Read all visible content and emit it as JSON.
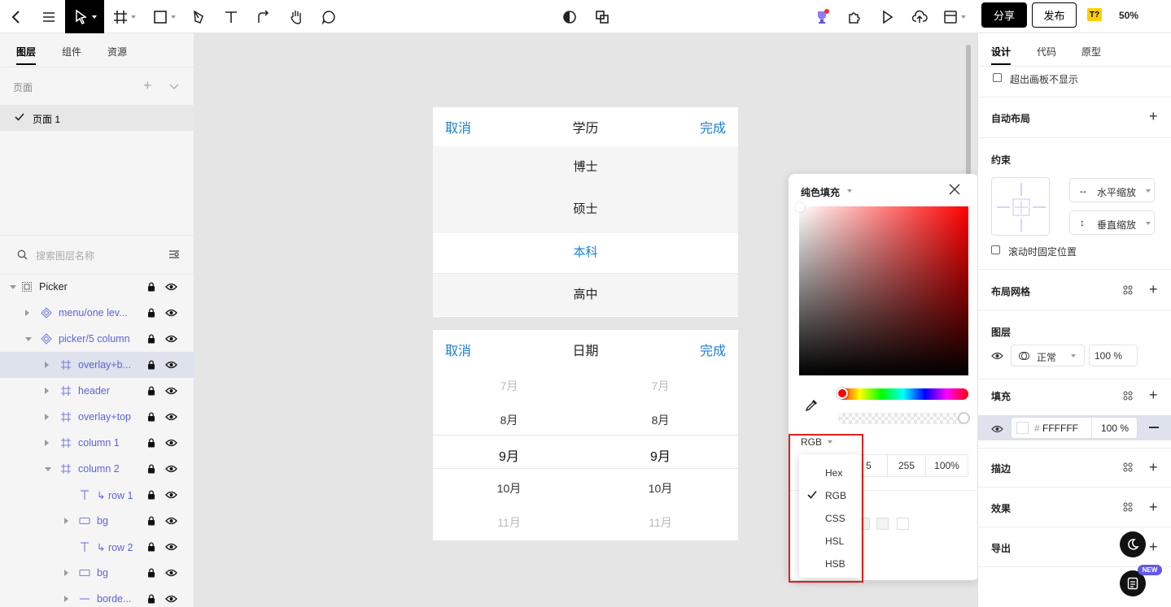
{
  "toolbar": {
    "back_icon": "chevron-left-icon",
    "menu_icon": "hamburger-icon",
    "share_label": "分享",
    "publish_label": "发布",
    "badge_label": "T?",
    "zoom_label": "50%"
  },
  "left_panel": {
    "tabs": [
      "图层",
      "组件",
      "资源"
    ],
    "pages_label": "页面",
    "page_name": "页面 1",
    "search_placeholder": "搜索图层名称",
    "layers": [
      {
        "name": "Picker",
        "icon": "frame-icon"
      },
      {
        "name": "menu/one lev...",
        "icon": "component-icon"
      },
      {
        "name": "picker/5 column",
        "icon": "component-icon"
      },
      {
        "name": "overlay+b...",
        "icon": "frame-icon"
      },
      {
        "name": "header",
        "icon": "frame-icon"
      },
      {
        "name": "overlay+top",
        "icon": "frame-icon"
      },
      {
        "name": "column 1",
        "icon": "frame-icon"
      },
      {
        "name": "column 2",
        "icon": "frame-icon"
      },
      {
        "name": "↳ row 1",
        "icon": "text-icon"
      },
      {
        "name": "bg",
        "icon": "rect-icon"
      },
      {
        "name": "↳ row 2",
        "icon": "text-icon"
      },
      {
        "name": "bg",
        "icon": "rect-icon"
      },
      {
        "name": "borde...",
        "icon": "line-icon"
      }
    ]
  },
  "canvas": {
    "picker1": {
      "cancel": "取消",
      "title": "学历",
      "done": "完成",
      "options": [
        "博士",
        "硕士",
        "本科",
        "高中"
      ],
      "selected_index": 2
    },
    "picker2": {
      "cancel": "取消",
      "title": "日期",
      "done": "完成",
      "col1": [
        "7月",
        "8月",
        "9月",
        "10月",
        "11月"
      ],
      "col2": [
        "7月",
        "8月",
        "9月",
        "10月",
        "11月"
      ]
    }
  },
  "fill_popup": {
    "title": "纯色填充",
    "mode": "RGB",
    "values": [
      "5",
      "255",
      "100%"
    ],
    "menu": [
      {
        "label": "Hex",
        "checked": false
      },
      {
        "label": "RGB",
        "checked": true
      },
      {
        "label": "CSS",
        "checked": false
      },
      {
        "label": "HSL",
        "checked": false
      },
      {
        "label": "HSB",
        "checked": false
      }
    ]
  },
  "right_panel": {
    "tabs": [
      "设计",
      "代码",
      "原型"
    ],
    "clip_label": "超出画板不显示",
    "auto_layout": "自动布局",
    "constraints": "约束",
    "horizontal": "水平缩放",
    "vertical": "垂直缩放",
    "fix_scroll": "滚动时固定位置",
    "layout_grid": "布局网格",
    "layer": "图层",
    "blend_mode": "正常",
    "layer_opacity": "100 %",
    "fill": "填充",
    "fill_hex_prefix": "#",
    "fill_hex": "FFFFFF",
    "fill_opacity": "100 %",
    "stroke": "描边",
    "effects": "效果",
    "export": "导出",
    "new_badge": "NEW"
  }
}
